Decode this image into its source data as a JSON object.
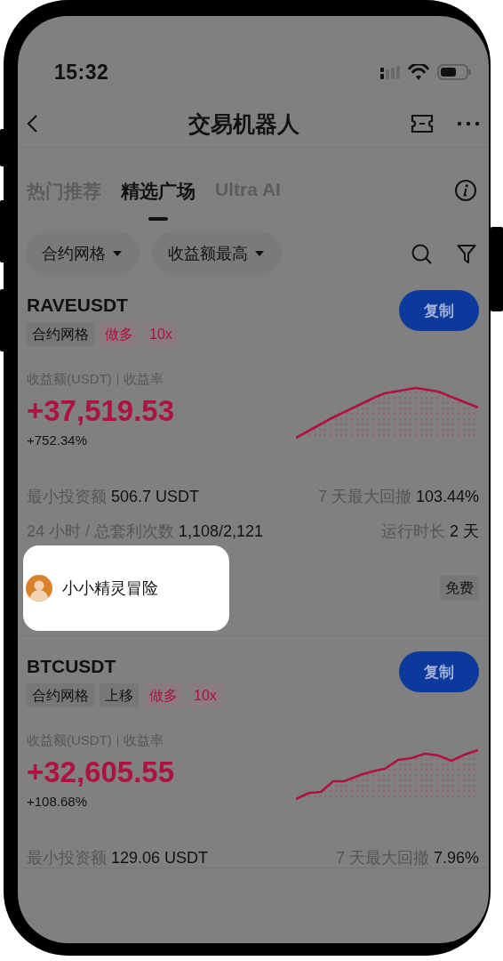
{
  "status_bar": {
    "time": "15:32"
  },
  "header": {
    "title": "交易机器人"
  },
  "tabs": [
    {
      "label": "热门推荐",
      "selected": false
    },
    {
      "label": "精选广场",
      "selected": true
    },
    {
      "label": "Ultra AI",
      "selected": false
    }
  ],
  "filters": [
    {
      "label": "合约网格"
    },
    {
      "label": "收益额最高"
    }
  ],
  "bots": [
    {
      "symbol": "RAVEUSDT",
      "tags": [
        {
          "label": "合约网格",
          "kind": "plain"
        },
        {
          "label": "做多",
          "kind": "accent"
        },
        {
          "label": "10x",
          "kind": "accent"
        }
      ],
      "copy_button": "复制",
      "profit_label": "收益额(USDT)",
      "rate_label": "收益率",
      "profit": "+37,519.53",
      "rate": "+752.34%",
      "stats": [
        {
          "label": "最小投资额",
          "value": "506.7 USDT"
        },
        {
          "label": "7 天最大回撤",
          "value": "103.44%"
        },
        {
          "label": "24 小时 / 总套利次数",
          "value": "1,108/2,121"
        },
        {
          "label": "运行时长",
          "value": "2 天"
        }
      ],
      "owner": {
        "name": "小小精灵冒险",
        "spotlight": true
      },
      "price_tag": "免费"
    },
    {
      "symbol": "BTCUSDT",
      "tags": [
        {
          "label": "合约网格",
          "kind": "plain"
        },
        {
          "label": "上移",
          "kind": "plain"
        },
        {
          "label": "做多",
          "kind": "accent"
        },
        {
          "label": "10x",
          "kind": "accent"
        }
      ],
      "copy_button": "复制",
      "profit_label": "收益额(USDT)",
      "rate_label": "收益率",
      "profit": "+32,605.55",
      "rate": "+108.68%",
      "stats": [
        {
          "label": "最小投资额",
          "value": "129.06 USDT"
        },
        {
          "label": "7 天最大回撤",
          "value": "7.96%"
        }
      ]
    }
  ]
}
